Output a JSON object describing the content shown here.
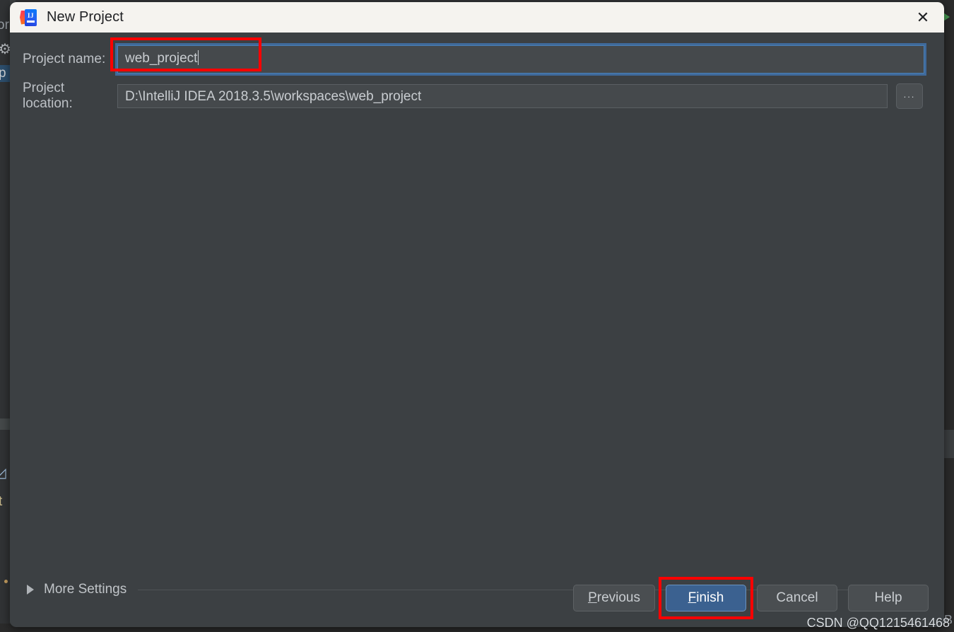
{
  "window": {
    "title": "New Project",
    "app_icon": "intellij-idea-logo",
    "close_icon": "✕"
  },
  "form": {
    "name_label": "Project name:",
    "name_value": "web_project",
    "location_label": "Project location:",
    "location_value": "D:\\IntelliJ IDEA 2018.3.5\\workspaces\\web_project",
    "browse_label": "...",
    "browse_icon": "ellipsis-icon"
  },
  "more_settings": {
    "label": "More Settings",
    "arrow_icon": "chevron-right-icon",
    "expanded": false
  },
  "buttons": {
    "previous": {
      "mnemonic": "P",
      "rest": "revious"
    },
    "finish": {
      "mnemonic": "F",
      "rest": "inish"
    },
    "cancel": "Cancel",
    "help": "Help"
  },
  "highlights": {
    "color": "#ff0000",
    "name_field": true,
    "finish_button": true
  },
  "watermark": "CSDN @QQ1215461468",
  "background": {
    "fragment_or": "or",
    "fragment_p": "p",
    "fragment_t": "t",
    "fragment_right": "B",
    "gear_icon": "⚙"
  },
  "colors": {
    "dialog_bg": "#3c4043",
    "titlebar_bg": "#f5f3ef",
    "accent_blue": "#3b6190",
    "focus_ring": "#3f6a9b",
    "highlight_red": "#ff0000"
  }
}
